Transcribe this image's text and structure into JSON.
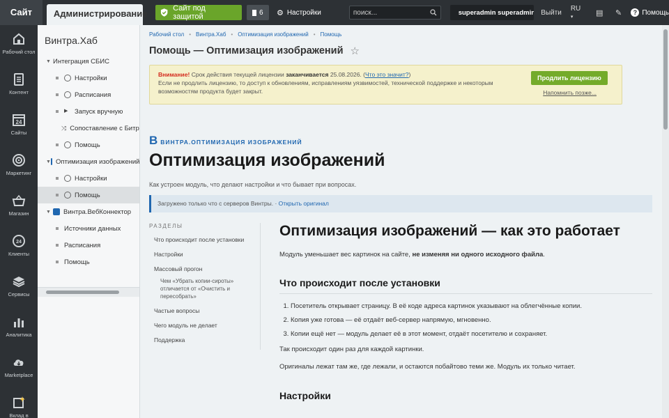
{
  "topbar": {
    "site_tab": "Сайт",
    "admin_tab": "Администрирование",
    "secure_label": "Сайт под защитой",
    "notifications_count": "6",
    "settings_label": "Настройки",
    "search_placeholder": "поиск...",
    "user_name": "superadmin superadmin",
    "logout_label": "Выйти",
    "lang_label": "RU",
    "help_label": "Помощь"
  },
  "leftmenu": {
    "items": [
      {
        "label": "Рабочий стол",
        "icon": "home-icon"
      },
      {
        "label": "Контент",
        "icon": "document-icon"
      },
      {
        "label": "Сайты",
        "icon": "calendar-icon"
      },
      {
        "label": "Маркетинг",
        "icon": "target-icon"
      },
      {
        "label": "Магазин",
        "icon": "basket-icon"
      },
      {
        "label": "Клиенты",
        "icon": "clients-icon"
      },
      {
        "label": "Сервисы",
        "icon": "layers-icon"
      },
      {
        "label": "Аналитика",
        "icon": "chart-icon"
      },
      {
        "label": "Marketplace",
        "icon": "cloud-icon"
      },
      {
        "label": "Вклад в Битрикс",
        "icon": "sparkle-icon"
      }
    ],
    "calendar_day": "24",
    "clients_badge": "24"
  },
  "tree": {
    "title": "Винтра.Хаб",
    "rows": [
      {
        "label": "Интеграция СБИС"
      },
      {
        "label": "Настройки"
      },
      {
        "label": "Расписания"
      },
      {
        "label": "Запуск вручную"
      },
      {
        "label": "Сопоставление с Битрикс"
      },
      {
        "label": "Помощь"
      },
      {
        "label": "Оптимизация изображений"
      },
      {
        "label": "Настройки"
      },
      {
        "label": "Помощь"
      },
      {
        "label": "Винтра.ВебКоннектор"
      },
      {
        "label": "Источники данных"
      },
      {
        "label": "Расписания"
      },
      {
        "label": "Помощь"
      }
    ]
  },
  "breadcrumb": {
    "items": [
      "Рабочий стол",
      "Винтра.Хаб",
      "Оптимизация изображений",
      "Помощь"
    ]
  },
  "page": {
    "title": "Помощь — Оптимизация изображений"
  },
  "warning": {
    "attention": "Внимание!",
    "text1": "Срок действия текущей лицензии",
    "text_bold": "заканчивается",
    "date": "25.08.2026.",
    "link": "Что это значит?",
    "text2": "Если не продлить лицензию, то доступ к обновлениям, исправлениям уязвимостей, технической поддержке и некоторым возможностям продукта будет закрыт.",
    "renew_label": "Продлить лицензию",
    "remind_label": "Напомнить позже..."
  },
  "doc": {
    "tag_letter": "В",
    "tag_text": "ВИНТРА.ОПТИМИЗАЦИЯ ИЗОБРАЖЕНИЙ",
    "h1": "Оптимизация изображений",
    "lead": "Как устроен модуль, что делают настройки и что бывает при вопросах.",
    "note_text": "Загружено только что с серверов Винтры. ·",
    "note_link": "Открыть оригинал",
    "toc_heading": "РАЗДЕЛЫ",
    "toc": [
      "Что происходит после установки",
      "Настройки",
      "Массовый прогон",
      "Чем «Убрать копии-сироты» отличается от «Очистить и пересобрать»",
      "Частые вопросы",
      "Чего модуль не делает",
      "Поддержка"
    ],
    "h2": "Оптимизация изображений — как это работает",
    "intro": "Модуль уменьшает вес картинок на сайте,",
    "intro_bold": "не изменяя ни одного исходного файла",
    "intro_end": ".",
    "h3": "Что происходит после установки",
    "steps": [
      "Посетитель открывает страницу. В её коде адреса картинок указывают на облегчённые копии.",
      "Копия уже готова — её отдаёт веб-сервер напрямую, мгновенно.",
      "Копии ещё нет — модуль делает её в этот момент, отдаёт посетителю и сохраняет."
    ],
    "p1": "Так происходит один раз для каждой картинки.",
    "p2": "Оригиналы лежат там же, где лежали, и остаются побайтово теми же. Модуль их только читает.",
    "h3b": "Настройки"
  },
  "colors": {
    "topbar": "#2d3135",
    "accent_green": "#6aa52a",
    "link_blue": "#2067b0",
    "warn_bg": "#f5f1cc",
    "attention_red": "#d42b1e"
  }
}
